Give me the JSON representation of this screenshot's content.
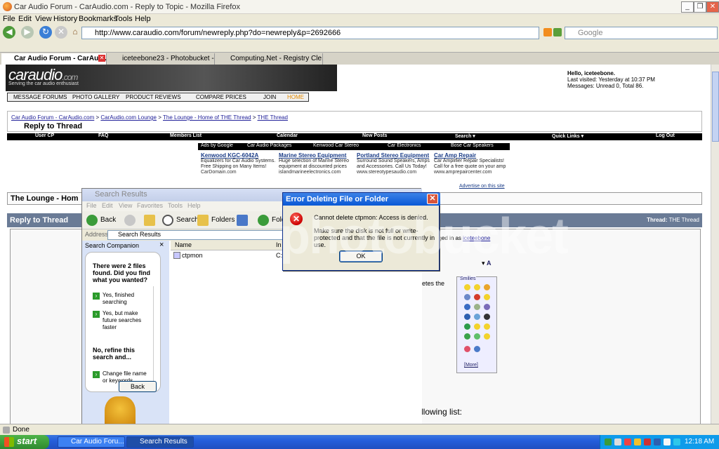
{
  "browser": {
    "title": "Car Audio Forum - CarAudio.com - Reply to Topic - Mozilla Firefox",
    "menu": [
      "File",
      "Edit",
      "View",
      "History",
      "Bookmarks",
      "Tools",
      "Help"
    ],
    "url": "http://www.caraudio.com/forum/newreply.php?do=newreply&p=2692666",
    "search_placeholder": "Google",
    "tabs": [
      {
        "label": "Car Audio Forum - CarAud...",
        "active": true
      },
      {
        "label": "iceteebone23 - Photobucket -...",
        "active": false
      },
      {
        "label": "Computing.Net - Registry Cle...",
        "active": false
      }
    ],
    "status": "Done"
  },
  "site": {
    "logo_name": "caraudio",
    "logo_suffix": ".com",
    "tagline": "Serving the car audio enthusiast",
    "hello_line1": "Hello, iceteebone.",
    "hello_line2": "Last visited: Yesterday at 10:37 PM",
    "hello_line3": "Messages: Unread 0, Total 86.",
    "nav": [
      "MESSAGE FORUMS",
      "PHOTO GALLERY",
      "PRODUCT REVIEWS",
      "COMPARE PRICES",
      "JOIN",
      "HOME"
    ],
    "breadcrumbs": [
      "Car Audio Forum - CarAudio.com",
      "CarAudio.com Lounge",
      "The Lounge - Home of THE Thread",
      "THE Thread"
    ],
    "page_title": "Reply to Thread",
    "blackbar": [
      "User CP",
      "FAQ",
      "Members List",
      "Calendar",
      "New Posts",
      "Search ▾",
      "Quick Links ▾",
      "Log Out"
    ],
    "ads_bar": [
      "Ads by Google",
      "Car Audio Packages",
      "Kenwood Car Stereo",
      "Car Electronics",
      "Bose Car Speakers"
    ],
    "ads": [
      {
        "title": "Kenwood KGC-6042A",
        "body": "Equalizers for Car Audio Systems. Free Shipping on Many Items!",
        "url": "CarDomain.com"
      },
      {
        "title": "Marine Stereo Equipment",
        "body": "Huge selection of Marine Stereo equipment at discounted prices",
        "url": "islandmarineelectronics.com"
      },
      {
        "title": "Portland Stereo Equipment",
        "body": "Surround Sound Speakers, Amps and Accessories. Call Us Today!",
        "url": "www.stereotypesaudio.com"
      },
      {
        "title": "Car Amp Repair",
        "body": "Car Amplifier Repair Specialists! Call for a free quote on your amp",
        "url": "www.amprepaircenter.com"
      }
    ],
    "advertise": "Advertise on this site",
    "lounge_title": "The Lounge - Hom",
    "reply_bar_left": "Reply to Thread",
    "reply_bar_right_label": "Thread:",
    "reply_bar_right_value": "THE Thread",
    "logged_in_prefix": "gged in as ",
    "logged_in_user": "iceteebone",
    "deletes_fragment": "etes the",
    "smilies_label": "Smilies",
    "more_label": "[More]",
    "follow_list": "llowing list:"
  },
  "search_window": {
    "title": "Search Results",
    "menu": [
      "File",
      "Edit",
      "View",
      "Favorites",
      "Tools",
      "Help"
    ],
    "toolbar": {
      "back": "Back",
      "search": "Search",
      "folders": "Folders",
      "folders_partial": "Folde"
    },
    "address_label": "Address",
    "address_value": "Search Results",
    "companion_title": "Search Companion",
    "question": "There were 2 files found. Did you find what you wanted?",
    "options": [
      "Yes, finished searching",
      "Yes, but make future searches faster"
    ],
    "refine": "No, refine this search and...",
    "refine_options": [
      "Change file name or keywords"
    ],
    "back_button": "Back",
    "columns": [
      "Name",
      "In"
    ],
    "file_name": "ctpmon",
    "file_in": "C:"
  },
  "error_dialog": {
    "title": "Error Deleting File or Folder",
    "message": "Cannot delete ctpmon: Access is denied.",
    "detail": "Make sure the disk is not full or write-protected and that the file is not currently in use.",
    "ok_label": "OK"
  },
  "taskbar": {
    "start": "start",
    "tasks": [
      "Car Audio Foru...",
      "Search Results"
    ],
    "clock": "12:18 AM"
  },
  "watermark": "photobucket"
}
